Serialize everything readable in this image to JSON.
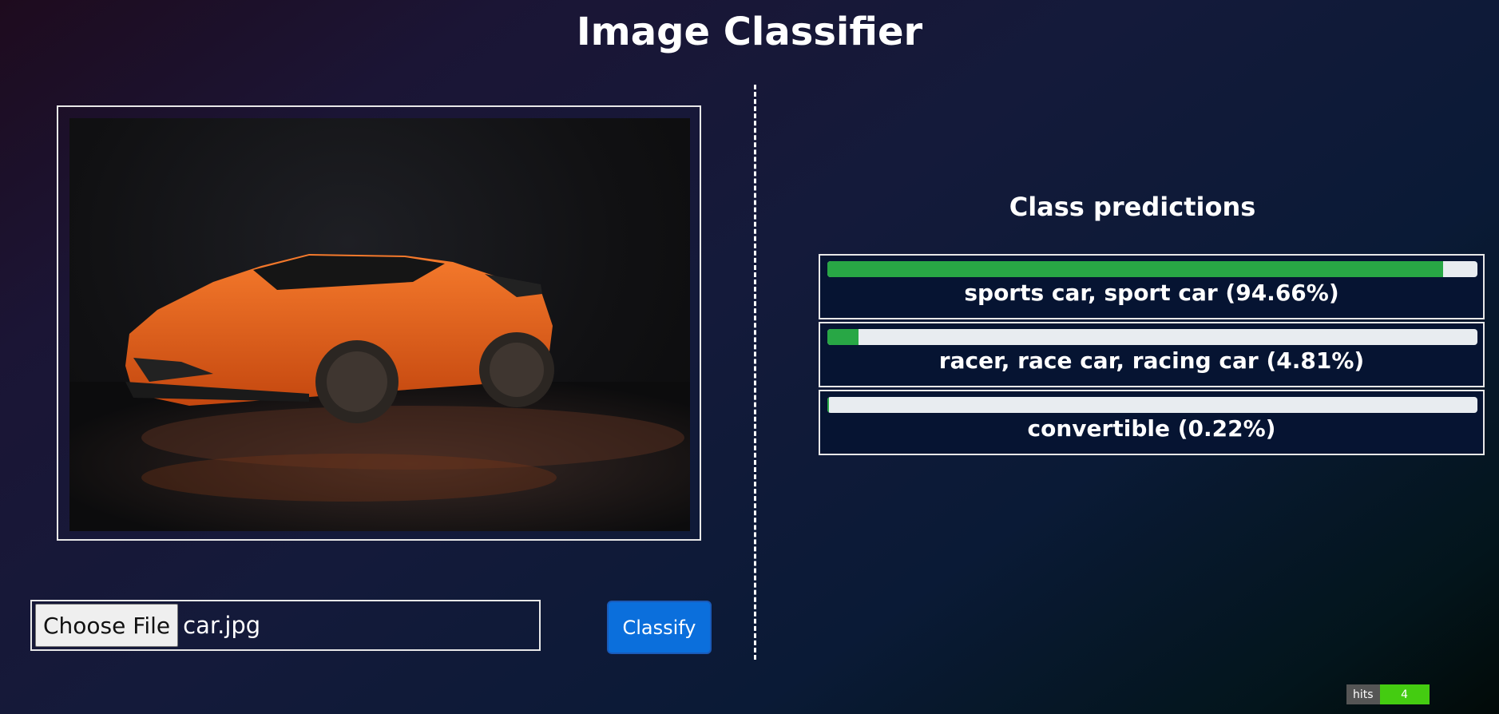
{
  "page": {
    "title": "Image Classifier"
  },
  "upload": {
    "choose_file_label": "Choose File",
    "file_name": "car.jpg",
    "classify_label": "Classify"
  },
  "predictions": {
    "heading": "Class predictions",
    "items": [
      {
        "label": "sports car, sport car (94.66%)",
        "probability": 0.9466
      },
      {
        "label": "racer, race car, racing car (4.81%)",
        "probability": 0.0481
      },
      {
        "label": "convertible (0.22%)",
        "probability": 0.0022
      }
    ]
  },
  "counter": {
    "label": "hits",
    "value": "4"
  },
  "colors": {
    "bar_fill": "#28a745",
    "button": "#0b6fdc",
    "car": "#e8621a"
  }
}
